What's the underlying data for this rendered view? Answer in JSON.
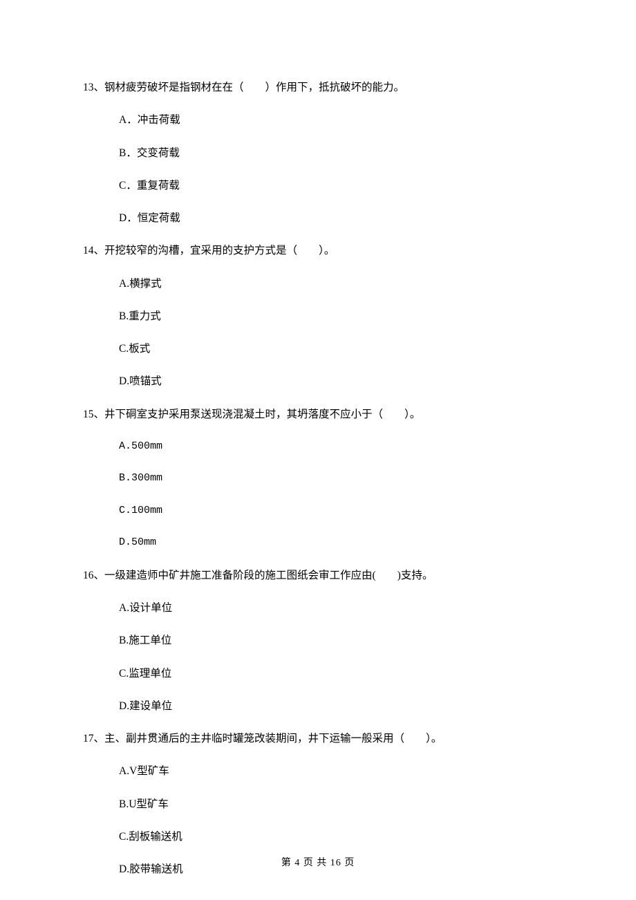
{
  "questions": [
    {
      "number": "13、",
      "stem": "钢材疲劳破坏是指钢材在在（　　）作用下，抵抗破坏的能力。",
      "options": [
        "A．冲击荷载",
        "B．交变荷载",
        "C．重复荷载",
        "D．恒定荷载"
      ]
    },
    {
      "number": "14、",
      "stem": "开挖较窄的沟槽，宜采用的支护方式是（　　）。",
      "options": [
        "A.横撑式",
        "B.重力式",
        "C.板式",
        "D.喷锚式"
      ]
    },
    {
      "number": "15、",
      "stem": "井下硐室支护采用泵送现浇混凝土时，其坍落度不应小于（　　）。",
      "options": [
        "A.500mm",
        "B.300mm",
        "C.100mm",
        "D.50mm"
      ]
    },
    {
      "number": "16、",
      "stem": "一级建造师中矿井施工准备阶段的施工图纸会审工作应由(　　)支持。",
      "options": [
        "A.设计单位",
        "B.施工单位",
        "C.监理单位",
        "D.建设单位"
      ]
    },
    {
      "number": "17、",
      "stem": "主、副井贯通后的主井临时罐笼改装期间，井下运输一般采用（　　）。",
      "options": [
        "A.V型矿车",
        "B.U型矿车",
        "C.刮板输送机",
        "D.胶带输送机"
      ]
    }
  ],
  "footer": "第 4 页 共 16 页"
}
